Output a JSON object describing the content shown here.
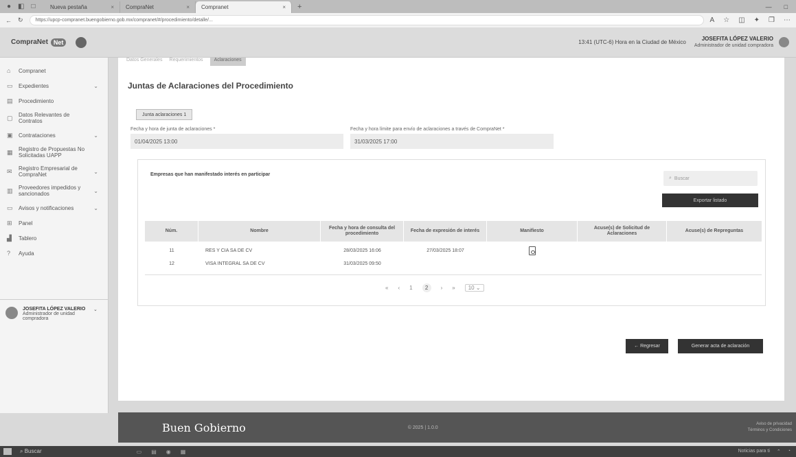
{
  "browser": {
    "tabs": [
      {
        "title": "Nueva pestaña",
        "active": false
      },
      {
        "title": "CompraNet",
        "active": false
      },
      {
        "title": "Compranet",
        "active": true
      }
    ],
    "url": "https://upcp-compranet.buengobierno.gob.mx/compranet/#/procedimiento/detalle/...",
    "window_controls": [
      "—",
      "□"
    ]
  },
  "header": {
    "logo_text": "CompraNet",
    "logo_badge": "Net",
    "time_text": "13:41 (UTC-6) Hora en la Ciudad de México",
    "user_name": "JOSEFITA LÓPEZ VALERIO",
    "user_role": "Administrador de unidad compradora"
  },
  "sidebar": {
    "items": [
      {
        "label": "Compranet",
        "icon": "home-icon",
        "chevron": false
      },
      {
        "label": "Expedientes",
        "icon": "folder-icon",
        "chevron": true
      },
      {
        "label": "Procedimiento",
        "icon": "document-icon",
        "chevron": false
      },
      {
        "label": "Datos Relevantes de Contratos",
        "icon": "file-icon",
        "chevron": false
      },
      {
        "label": "Contrataciones",
        "icon": "cart-icon",
        "chevron": true
      },
      {
        "label": "Registro de Propuestas No Solicitadas UAPP",
        "icon": "register-icon",
        "chevron": false
      },
      {
        "label": "Registro Empresarial de CompraNet",
        "icon": "mail-icon",
        "chevron": true
      },
      {
        "label": "Proveedores impedidos y sancionados",
        "icon": "building-icon",
        "chevron": true
      },
      {
        "label": "Avisos y notificaciones",
        "icon": "bell-icon",
        "chevron": true
      },
      {
        "label": "Panel",
        "icon": "panel-icon",
        "chevron": false
      },
      {
        "label": "Tablero",
        "icon": "chart-icon",
        "chevron": false
      },
      {
        "label": "Ayuda",
        "icon": "help-icon",
        "chevron": false
      }
    ],
    "user": {
      "name": "JOSEFITA LÓPEZ VALERIO",
      "role": "Administrador de unidad compradora"
    }
  },
  "main": {
    "subnav": [
      "Datos Generales",
      "Requerimientos",
      "Aclaraciones"
    ],
    "title": "Juntas de Aclaraciones del Procedimiento",
    "tab_label": "Junta aclaraciones 1",
    "field1_label": "Fecha y hora de junta de aclaraciones *",
    "field1_value": "01/04/2025 13:00",
    "field2_label": "Fecha y hora límite para envío de aclaraciones a través de CompraNet *",
    "field2_value": "31/03/2025 17:00",
    "card_title": "Empresas que han manifestado interés en participar",
    "search_placeholder": "Buscar",
    "export_label": "Exportar listado",
    "columns": [
      "Núm.",
      "Nombre",
      "Fecha y hora de consulta del procedimiento",
      "Fecha de expresión de interés",
      "Manifiesto",
      "Acuse(s) de Solicitud de Aclaraciones",
      "Acuse(s) de Repreguntas"
    ],
    "rows": [
      {
        "num": "11",
        "nombre": "RES Y CIA SA DE CV",
        "consulta": "28/03/2025 16:06",
        "interes": "27/03/2025 18:07",
        "manifiesto": true
      },
      {
        "num": "12",
        "nombre": "VISA INTEGRAL SA DE CV",
        "consulta": "31/03/2025 09:50",
        "interes": "",
        "manifiesto": false
      }
    ],
    "pager": {
      "first": "«",
      "prev": "‹",
      "page1": "1",
      "page2": "2",
      "next": "›",
      "last": "»",
      "per_page": "10"
    },
    "back_label": "← Regresar",
    "acta_label": "Generar acta de aclaración"
  },
  "footer": {
    "brand": "Buen Gobierno",
    "copyright": "© 2025 | 1.0.0",
    "link1": "Aviso de privacidad",
    "link2": "Términos y Condiciones"
  },
  "taskbar": {
    "search": "Buscar",
    "tray": "Noticias para ti"
  }
}
